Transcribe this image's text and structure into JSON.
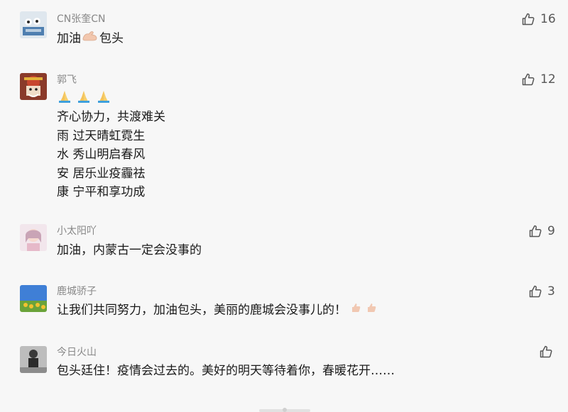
{
  "comments": [
    {
      "name": "CN张奎CN",
      "text": "加油",
      "text_after": "包头",
      "emoji": "muscle",
      "likes": "16"
    },
    {
      "name": "郭飞",
      "emoji_line": "pray-pray-pray",
      "lines": [
        "齐心协力，共渡难关",
        "雨 过天晴虹霓生",
        "水 秀山明启春风",
        "安 居乐业疫霾祛",
        "康 宁平和享功成"
      ],
      "likes": "12"
    },
    {
      "name": "小太阳吖",
      "text": "加油，内蒙古一定会没事的",
      "likes": "9"
    },
    {
      "name": "鹿城骄子",
      "text": "让我们共同努力，加油包头，美丽的鹿城会没事儿的！",
      "emoji": "thumbs-up-thumbs-up",
      "likes": "3"
    },
    {
      "name": "今日火山",
      "text": "包头廷住！疫情会过去的。美好的明天等待着你，春暖花开……",
      "likes": ""
    }
  ],
  "icons": {
    "like": "thumbs-up-outline-icon"
  },
  "colors": {
    "background": "#f7f7f7",
    "name": "#888888",
    "text": "#1a1a1a",
    "like": "#575757"
  }
}
